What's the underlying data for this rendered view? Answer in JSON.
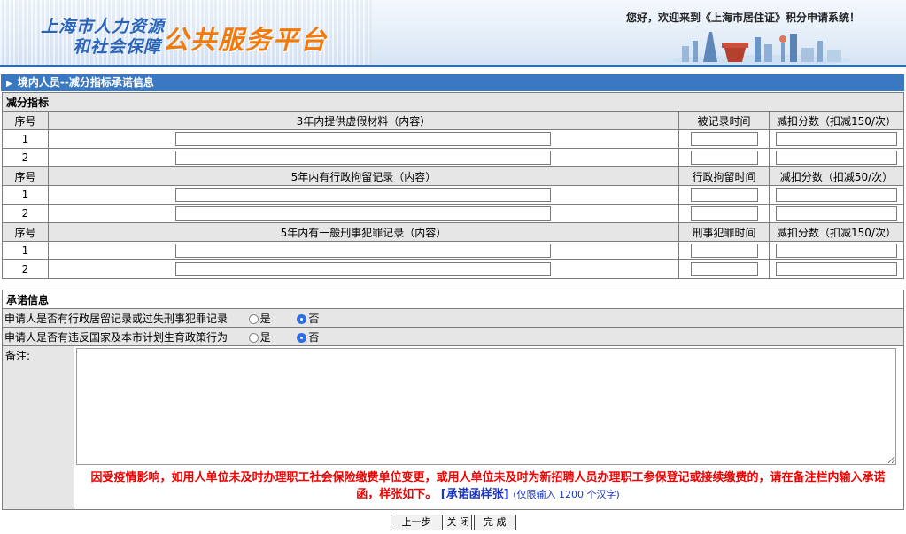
{
  "header": {
    "logo_line1": "上海市人力资源",
    "logo_line2": "和社会保障",
    "logo_platform": "公共服务平台",
    "welcome": "您好，欢迎来到《上海市居住证》积分申请系统！"
  },
  "section_title": "境内人员--减分指标承诺信息",
  "deduction": {
    "title": "减分指标",
    "seq_header": "序号",
    "groups": [
      {
        "content_header": "3年内提供虚假材料（内容）",
        "time_header": "被记录时间",
        "score_header": "减扣分数（扣减150/次）",
        "rows": [
          "1",
          "2"
        ]
      },
      {
        "content_header": "5年内有行政拘留记录（内容）",
        "time_header": "行政拘留时间",
        "score_header": "减扣分数（扣减50/次）",
        "rows": [
          "1",
          "2"
        ]
      },
      {
        "content_header": "5年内有一般刑事犯罪记录（内容）",
        "time_header": "刑事犯罪时间",
        "score_header": "减扣分数（扣减150/次）",
        "rows": [
          "1",
          "2"
        ]
      }
    ]
  },
  "commitment": {
    "title": "承诺信息",
    "q1": "申请人是否有行政居留记录或过失刑事犯罪记录",
    "q2": "申请人是否有违反国家及本市计划生育政策行为",
    "yes": "是",
    "no": "否",
    "q1_selected": "否",
    "q2_selected": "否"
  },
  "notes": {
    "label": "备注:",
    "value": "",
    "notice_main": "因受疫情影响，如用人单位未及时办理职工社会保险缴费单位变更，或用人单位未及时为新招聘人员办理职工参保登记或接续缴费的，请在备注栏内输入承诺函，样张如下。",
    "notice_link": "[承诺函样张]",
    "notice_limit": "(仅限输入 1200 个汉字)"
  },
  "buttons": {
    "prev": "上一步",
    "close": "关 闭",
    "finish": "完 成"
  }
}
